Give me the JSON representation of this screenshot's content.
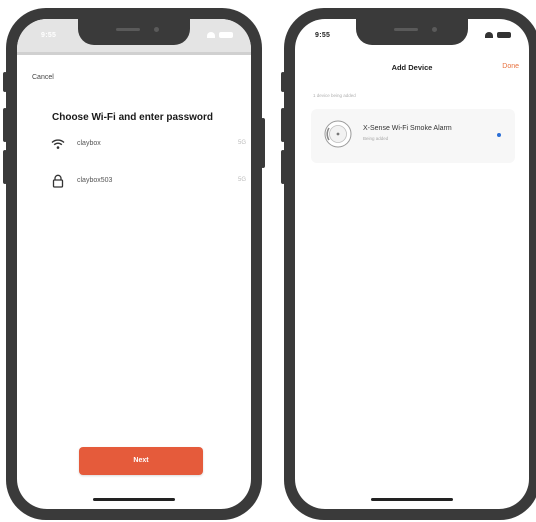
{
  "left_screen": {
    "status_time": "9:55",
    "cancel_label": "Cancel",
    "title": "Choose Wi-Fi and enter password",
    "networks": [
      {
        "icon": "wifi-icon",
        "name": "claybox",
        "meta": "5G"
      },
      {
        "icon": "lock-icon",
        "name": "claybox503",
        "meta": "5G"
      }
    ],
    "next_label": "Next"
  },
  "right_screen": {
    "status_time": "9:55",
    "nav_title": "Add Device",
    "done_label": "Done",
    "section_caption": "1 device being added",
    "device": {
      "icon": "smoke-alarm-icon",
      "name": "X-Sense Wi-Fi Smoke Alarm",
      "status": "Being added"
    }
  },
  "colors": {
    "phone_frame": "#3a3a3a",
    "accent": "#e55b3b",
    "done": "#e8723f",
    "status_dot": "#2b6fd6"
  }
}
